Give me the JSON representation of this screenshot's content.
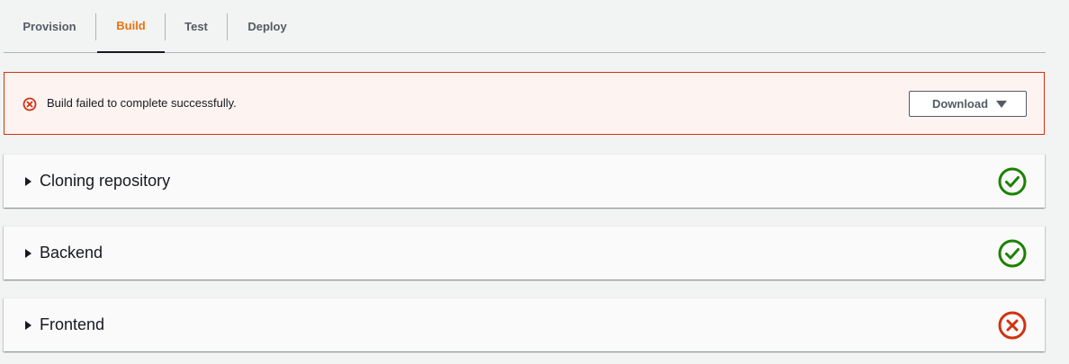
{
  "tabs": [
    {
      "label": "Provision",
      "active": false
    },
    {
      "label": "Build",
      "active": true
    },
    {
      "label": "Test",
      "active": false
    },
    {
      "label": "Deploy",
      "active": false
    }
  ],
  "alert": {
    "icon": "error-icon",
    "message": "Build failed to complete successfully.",
    "download_label": "Download"
  },
  "steps": [
    {
      "label": "Cloning repository",
      "status": "success"
    },
    {
      "label": "Backend",
      "status": "success"
    },
    {
      "label": "Frontend",
      "status": "failed"
    }
  ],
  "colors": {
    "accent": "#ec7211",
    "error": "#d13212",
    "success": "#1d8102"
  }
}
